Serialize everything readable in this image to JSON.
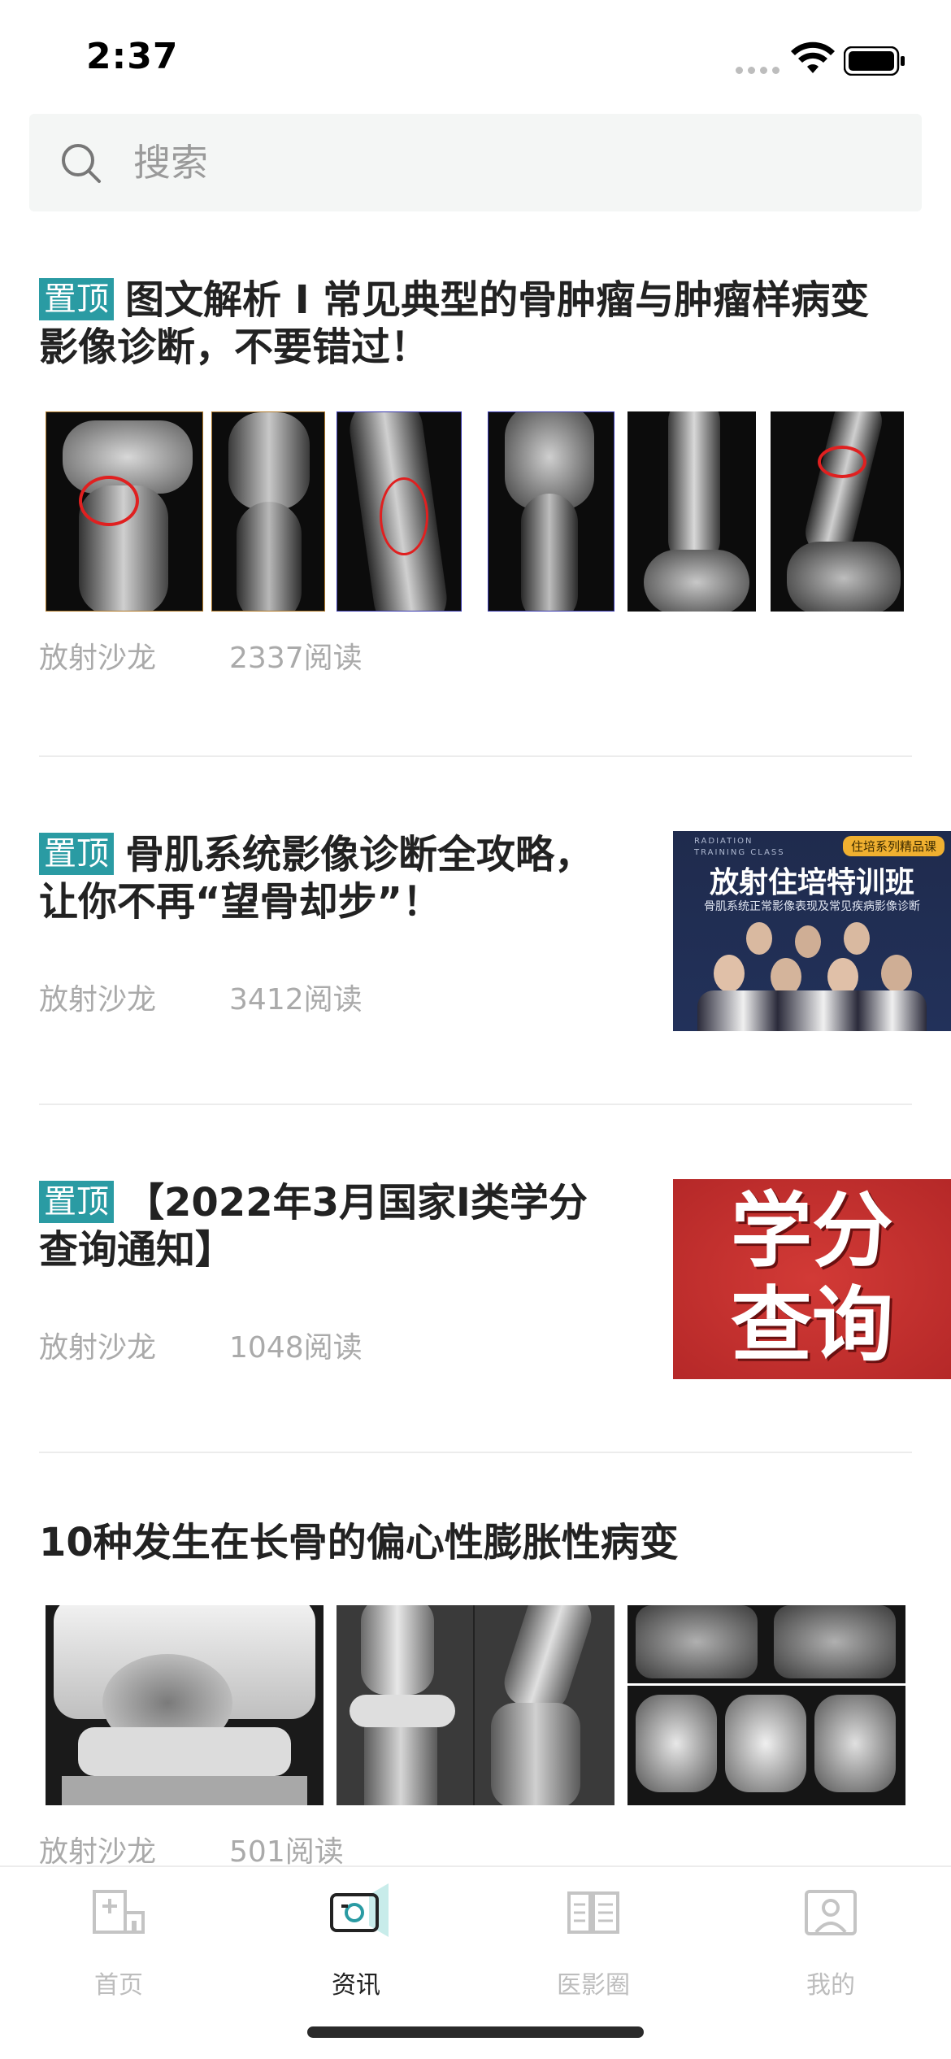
{
  "status_bar": {
    "time": "2:37"
  },
  "search": {
    "placeholder": "搜索"
  },
  "articles": [
    {
      "pinned_label": "置顶",
      "title": "图文解析 I 常见典型的骨肿瘤与肿瘤样病变影像诊断，不要错过！",
      "source": "放射沙龙",
      "reads": "2337阅读"
    },
    {
      "pinned_label": "置顶",
      "title": "骨肌系统影像诊断全攻略，让你不再“望骨却步”！",
      "source": "放射沙龙",
      "reads": "3412阅读",
      "thumb": {
        "tag": "住培系列精品课",
        "eyebrow": "RADIATION TRAINING CLASS",
        "headline": "放射住培特训班",
        "subtitle": "骨肌系统正常影像表现及常见疾病影像诊断"
      }
    },
    {
      "pinned_label": "置顶",
      "title": "【2022年3月国家I类学分查询通知】",
      "source": "放射沙龙",
      "reads": "1048阅读",
      "thumb": {
        "line1": "学分",
        "line2": "查询"
      }
    },
    {
      "title": "10种发生在长骨的偏心性膨胀性病变",
      "source": "放射沙龙",
      "reads": "501阅读"
    }
  ],
  "tabs": [
    {
      "label": "首页",
      "icon": "home-icon",
      "active": false
    },
    {
      "label": "资讯",
      "icon": "news-icon",
      "active": true
    },
    {
      "label": "医影圈",
      "icon": "community-icon",
      "active": false
    },
    {
      "label": "我的",
      "icon": "profile-icon",
      "active": false
    }
  ],
  "colors": {
    "accent": "#2a9ba3",
    "pin_bg": "#2a9ba3",
    "meta_text": "#aaaaaa"
  }
}
